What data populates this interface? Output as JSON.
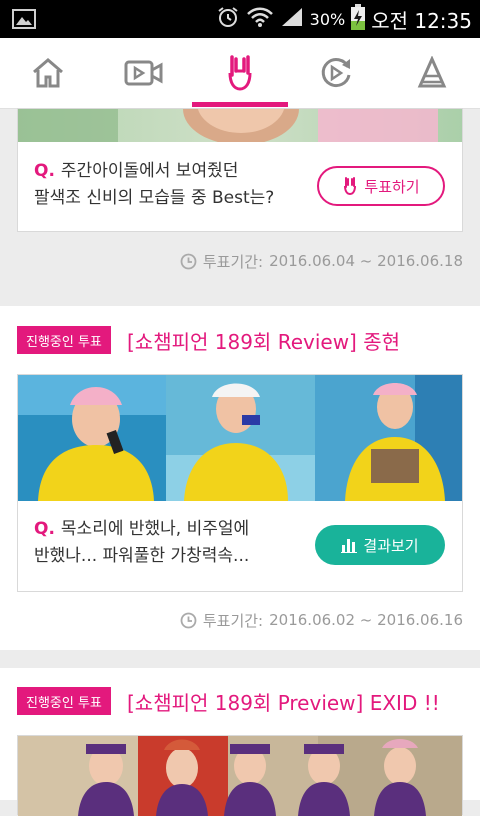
{
  "status_bar": {
    "battery_percent": "30%",
    "time": "오전 12:35"
  },
  "nav": {
    "tabs": [
      {
        "icon": "home-icon"
      },
      {
        "icon": "video-icon"
      },
      {
        "icon": "rock-hand-icon",
        "active": true
      },
      {
        "icon": "replay-icon"
      },
      {
        "icon": "cone-icon"
      }
    ],
    "accent": "#e3197d"
  },
  "cards": [
    {
      "question_mark": "Q.",
      "question_line1": "주간아이돌에서 보여줬던",
      "question_line2": "팔색조 신비의 모습들 중 Best는?",
      "button_label": "투표하기",
      "period_label": "투표기간:",
      "period_range": "2016.06.04 ~ 2016.06.18"
    },
    {
      "badge": "진행중인 투표",
      "title": "[쇼챔피언 189회 Review] 종현",
      "question_mark": "Q.",
      "question_line1": "목소리에 반했나, 비주얼에",
      "question_line2": "반했나... 파워풀한 가창력속...",
      "button_label": "결과보기",
      "period_label": "투표기간:",
      "period_range": "2016.06.02 ~ 2016.06.16"
    },
    {
      "badge": "진행중인 투표",
      "title": "[쇼챔피언 189회 Preview] EXID !!"
    }
  ],
  "colors": {
    "primary": "#e3197d",
    "result_button": "#19b39a",
    "muted_text": "#9a9a9a"
  }
}
